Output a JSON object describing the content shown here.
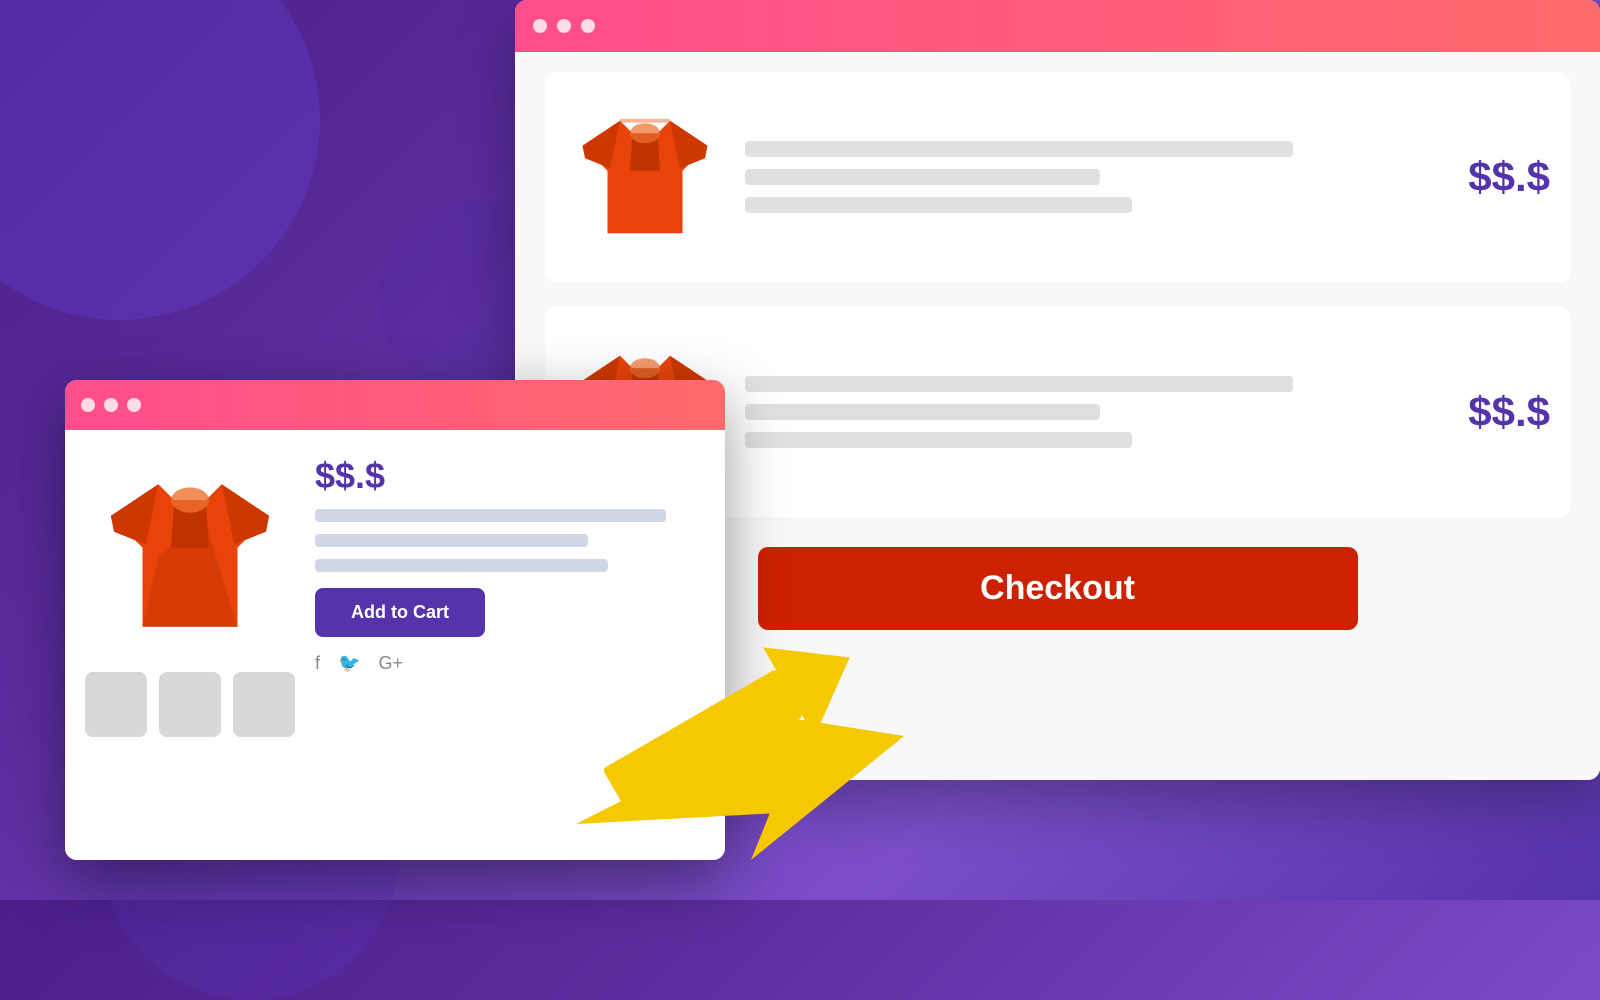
{
  "background": {
    "color_start": "#4a1f8a",
    "color_end": "#7b4ec8"
  },
  "browser_back": {
    "titlebar_dots": [
      "dot1",
      "dot2",
      "dot3"
    ],
    "products": [
      {
        "price": "$$.$ ",
        "lines": [
          "long",
          "medium",
          "short"
        ]
      },
      {
        "price": "$$.$ ",
        "lines": [
          "long",
          "medium",
          "short"
        ]
      }
    ],
    "checkout_button_label": "Checkout"
  },
  "browser_front": {
    "titlebar_dots": [
      "dot1",
      "dot2",
      "dot3"
    ],
    "price": "$$.$",
    "add_to_cart_label": "Add to Cart",
    "social": [
      "f",
      "𝕥",
      "G+"
    ]
  },
  "arrow": {
    "color": "#f5c800"
  }
}
